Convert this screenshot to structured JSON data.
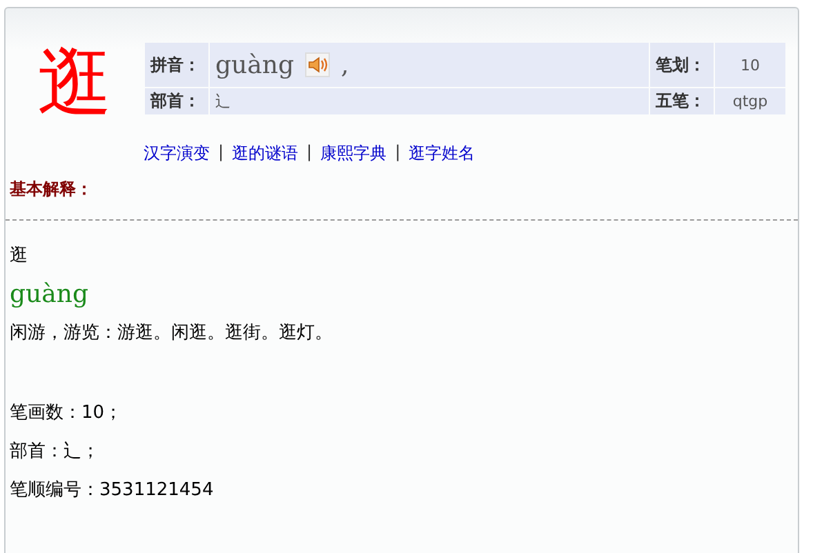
{
  "character": "逛",
  "info_table": [
    [
      {
        "label": "拼音：",
        "value": "guàng",
        "sound": true,
        "suffix": ","
      },
      {
        "label": "笔划：",
        "value": "10"
      }
    ],
    [
      {
        "label": "部首：",
        "value": "辶",
        "sound": false
      },
      {
        "label": "五笔：",
        "value": "qtgp"
      }
    ]
  ],
  "links": [
    "汉字演变",
    "逛的谜语",
    "康熙字典",
    "逛字姓名"
  ],
  "link_separator": "|",
  "section_title": "基本解释：",
  "entry": {
    "character": "逛",
    "pinyin": "guàng",
    "definition": "闲游，游览：游逛。闲逛。逛街。逛灯。"
  },
  "facts": [
    "笔画数：10；",
    "部首：辶；",
    "笔顺编号：3531121454"
  ]
}
